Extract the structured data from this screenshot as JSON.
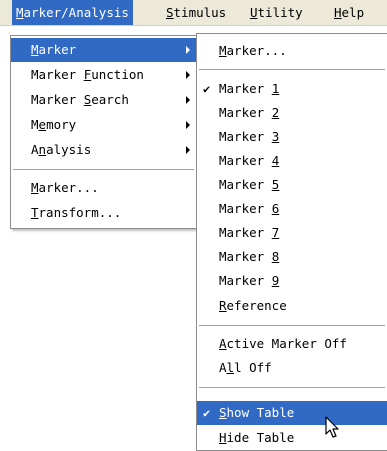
{
  "menubar": {
    "items": [
      {
        "pre": "",
        "key": "M",
        "post": "arker/Analysis"
      },
      {
        "pre": "",
        "key": "S",
        "post": "timulus"
      },
      {
        "pre": "",
        "key": "U",
        "post": "tility"
      },
      {
        "pre": "",
        "key": "H",
        "post": "elp"
      }
    ]
  },
  "menu1": {
    "items": [
      {
        "pre": "",
        "key": "M",
        "post": "arker"
      },
      {
        "pre": "Marker ",
        "key": "F",
        "post": "unction"
      },
      {
        "pre": "Marker ",
        "key": "S",
        "post": "earch"
      },
      {
        "pre": "M",
        "key": "e",
        "post": "mory"
      },
      {
        "pre": "A",
        "key": "n",
        "post": "alysis"
      },
      {
        "pre": "",
        "key": "M",
        "post": "arker..."
      },
      {
        "pre": "",
        "key": "T",
        "post": "ransform..."
      }
    ]
  },
  "menu2": {
    "items": [
      {
        "pre": "",
        "key": "M",
        "post": "arker..."
      },
      {
        "pre": "Marker ",
        "key": "1",
        "post": ""
      },
      {
        "pre": "Marker ",
        "key": "2",
        "post": ""
      },
      {
        "pre": "Marker ",
        "key": "3",
        "post": ""
      },
      {
        "pre": "Marker ",
        "key": "4",
        "post": ""
      },
      {
        "pre": "Marker ",
        "key": "5",
        "post": ""
      },
      {
        "pre": "Marker ",
        "key": "6",
        "post": ""
      },
      {
        "pre": "Marker ",
        "key": "7",
        "post": ""
      },
      {
        "pre": "Marker ",
        "key": "8",
        "post": ""
      },
      {
        "pre": "Marker ",
        "key": "9",
        "post": ""
      },
      {
        "pre": "",
        "key": "R",
        "post": "eference"
      },
      {
        "pre": "",
        "key": "A",
        "post": "ctive Marker Off"
      },
      {
        "pre": "A",
        "key": "l",
        "post": "l Off"
      },
      {
        "pre": "",
        "key": "S",
        "post": "how Table"
      },
      {
        "pre": "",
        "key": "H",
        "post": "ide Table"
      }
    ],
    "check_mark": "✔"
  },
  "colors": {
    "highlight": "#316ac5",
    "menubar_bg": "#ece9d8"
  }
}
